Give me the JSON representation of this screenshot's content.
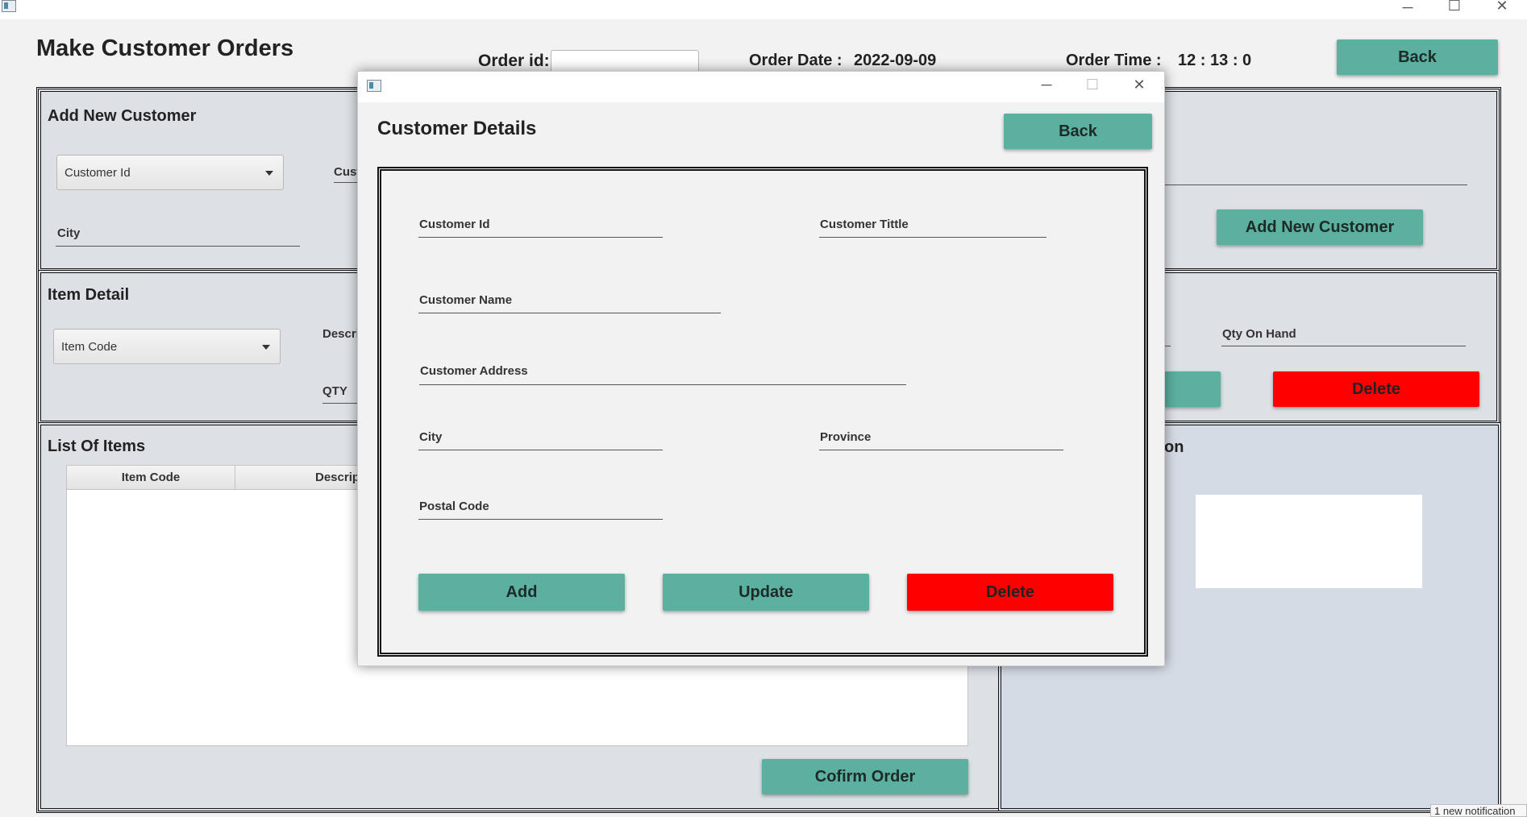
{
  "window": {
    "title": "",
    "controls": {
      "minimize": "─",
      "maximize": "☐",
      "close": "✕"
    }
  },
  "header": {
    "title": "Make Customer Orders",
    "order_id_label": "Order id:",
    "order_id_value": "",
    "order_date_label": "Order Date :",
    "order_date_value": "2022-09-09",
    "order_time_label": "Order Time :",
    "order_time_value": "12 : 13 : 0",
    "back_label": "Back"
  },
  "customer_section": {
    "title": "Add New Customer",
    "customer_id_combo": "Customer Id",
    "customer_title_partial": "Cust",
    "city_label": "City",
    "add_new_customer_label": "Add New Customer"
  },
  "item_section": {
    "title": "Item Detail",
    "item_code_combo": "Item Code",
    "description_partial": "Descri",
    "qty_label": "QTY",
    "qty_on_hand_label": "Qty On Hand",
    "delete_label": "Delete"
  },
  "list_section": {
    "title": "List Of Items",
    "columns": [
      "Item Code",
      "Descrip"
    ],
    "confirm_label": "Cofirm Order"
  },
  "right_bottom": {
    "title_partial": "on"
  },
  "dialog": {
    "title": "Customer Details",
    "back_label": "Back",
    "fields": {
      "customer_id": "Customer Id",
      "customer_title": "Customer Tittle",
      "customer_name": "Customer Name",
      "customer_address": "Customer Address",
      "city": "City",
      "province": "Province",
      "postal_code": "Postal Code"
    },
    "add_label": "Add",
    "update_label": "Update",
    "delete_label": "Delete"
  },
  "notification": {
    "text": "1 new notification"
  },
  "colors": {
    "accent": "#5bb09f",
    "danger": "#ff0000",
    "panel": "#dde1e6"
  },
  "icons": [
    "app-icon",
    "minimize-icon",
    "maximize-icon",
    "close-icon",
    "dropdown-arrow-icon"
  ]
}
